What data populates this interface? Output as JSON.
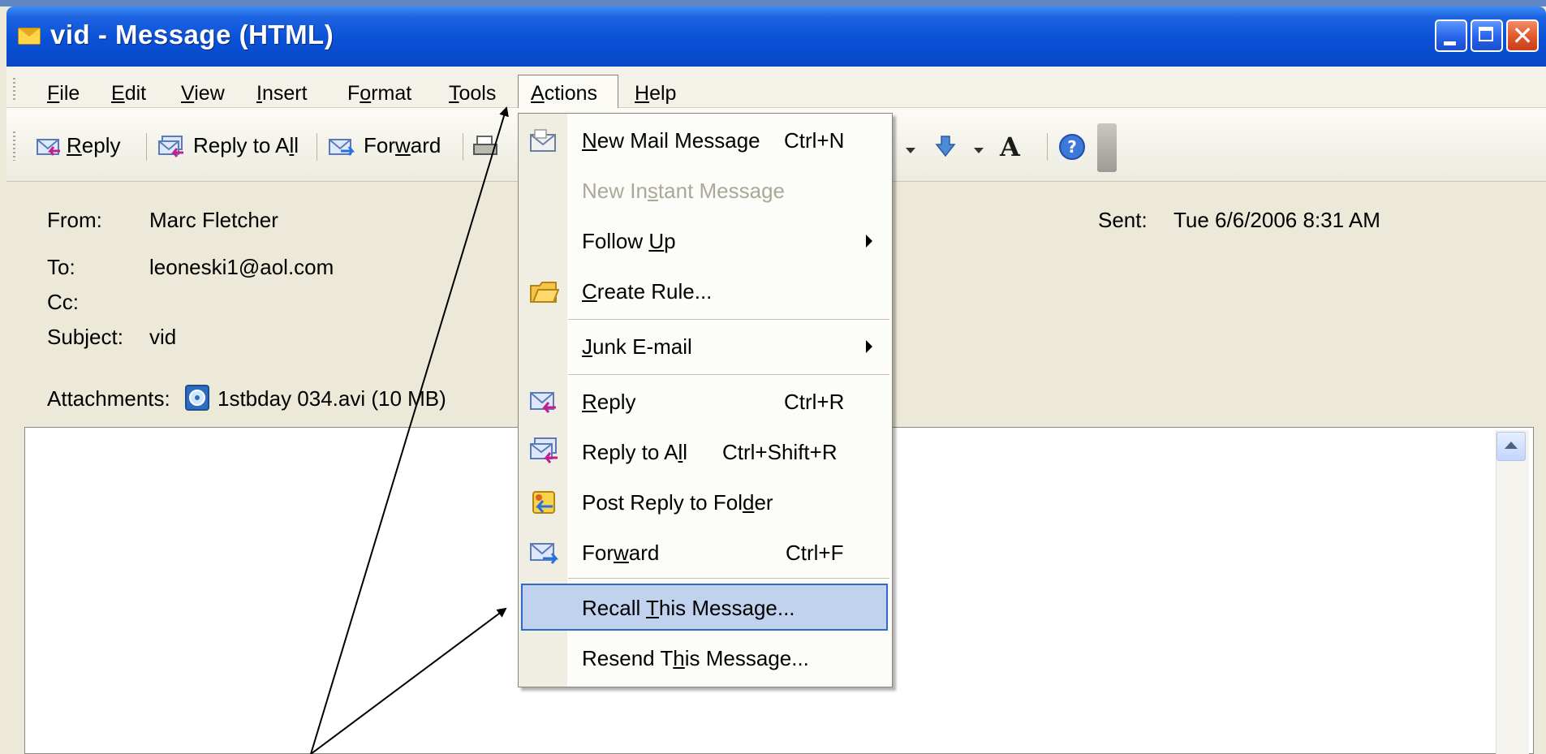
{
  "window": {
    "title": "vid - Message (HTML)",
    "title_icon": "envelope-icon",
    "controls": [
      "minimize-icon",
      "maximize-icon",
      "close-icon"
    ],
    "close_glyph": "✕"
  },
  "menubar": {
    "items": [
      {
        "pre": "",
        "u": "F",
        "post": "ile"
      },
      {
        "pre": "",
        "u": "E",
        "post": "dit"
      },
      {
        "pre": "",
        "u": "V",
        "post": "iew"
      },
      {
        "pre": "",
        "u": "I",
        "post": "nsert"
      },
      {
        "pre": "F",
        "u": "o",
        "post": "rmat"
      },
      {
        "pre": "",
        "u": "T",
        "post": "ools"
      },
      {
        "pre": "",
        "u": "A",
        "post": "ctions"
      },
      {
        "pre": "",
        "u": "H",
        "post": "elp"
      }
    ]
  },
  "toolbar": {
    "reply": {
      "pre": "",
      "u": "R",
      "post": "eply"
    },
    "reply_all": {
      "pre": "Reply to A",
      "u": "l",
      "post": "l"
    },
    "forward": {
      "pre": "For",
      "u": "w",
      "post": "ard"
    },
    "font_size_glyph": "A",
    "icons": [
      "reply-icon",
      "reply-all-icon",
      "forward-icon",
      "print-icon",
      "down-arrow-icon",
      "help-icon"
    ]
  },
  "header": {
    "from_label": "From:",
    "from_value": "Marc Fletcher",
    "to_label": "To:",
    "to_value": "leoneski1@aol.com",
    "cc_label": "Cc:",
    "cc_value": "",
    "subject_label": "Subject:",
    "subject_value": "vid",
    "attachments_label": "Attachments:",
    "attachment_name": "1stbday 034.avi (10 MB)",
    "sent_label": "Sent:",
    "sent_value": "Tue 6/6/2006 8:31 AM"
  },
  "actions_menu": {
    "new_mail": {
      "pre": "",
      "u": "N",
      "post": "ew Mail Message",
      "shortcut": "Ctrl+N"
    },
    "new_im": {
      "pre": "New In",
      "u": "s",
      "post": "tant Message",
      "disabled": true
    },
    "follow_up": {
      "pre": "Follow ",
      "u": "U",
      "post": "p"
    },
    "create_rule": {
      "pre": "",
      "u": "C",
      "post": "reate Rule..."
    },
    "junk": {
      "pre": "",
      "u": "J",
      "post": "unk E-mail"
    },
    "reply": {
      "pre": "",
      "u": "R",
      "post": "eply",
      "shortcut": "Ctrl+R"
    },
    "reply_all": {
      "pre": "Reply to A",
      "u": "l",
      "post": "l",
      "shortcut": "Ctrl+Shift+R"
    },
    "post_reply": {
      "pre": "Post Reply to Fol",
      "u": "d",
      "post": "er"
    },
    "forward": {
      "pre": "For",
      "u": "w",
      "post": "ard",
      "shortcut": "Ctrl+F"
    },
    "recall": {
      "pre": "Recall ",
      "u": "T",
      "post": "his Message...",
      "highlighted": true
    },
    "resend": {
      "pre": "Resend T",
      "u": "h",
      "post": "is Message..."
    }
  },
  "colors": {
    "titlebar": "#0a51d8",
    "menu_highlight": "#c1d2ee",
    "menu_highlight_border": "#316ac5",
    "disabled_text": "#aca899"
  }
}
